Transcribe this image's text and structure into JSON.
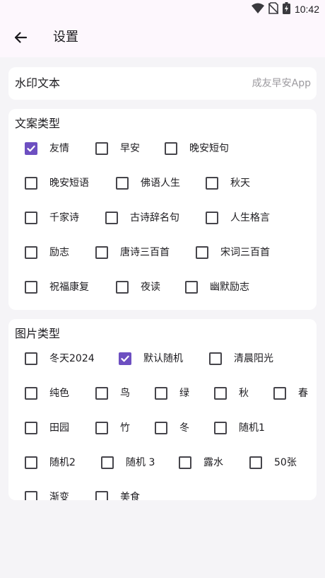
{
  "status": {
    "time": "10:42"
  },
  "header": {
    "title": "设置",
    "back_icon": "arrow-left-icon"
  },
  "watermark": {
    "label": "水印文本",
    "placeholder": "成友早安App",
    "value": ""
  },
  "text_types": {
    "title": "文案类型",
    "options": [
      {
        "label": "友情",
        "checked": true
      },
      {
        "label": "早安",
        "checked": false
      },
      {
        "label": "晚安短句",
        "checked": false
      },
      {
        "label": "晚安短语",
        "checked": false
      },
      {
        "label": "佛语人生",
        "checked": false
      },
      {
        "label": "秋天",
        "checked": false
      },
      {
        "label": "千家诗",
        "checked": false
      },
      {
        "label": "古诗辞名句",
        "checked": false
      },
      {
        "label": "人生格言",
        "checked": false
      },
      {
        "label": "励志",
        "checked": false
      },
      {
        "label": "唐诗三百首",
        "checked": false
      },
      {
        "label": "宋词三百首",
        "checked": false
      },
      {
        "label": "祝福康复",
        "checked": false
      },
      {
        "label": "夜读",
        "checked": false
      },
      {
        "label": "幽默励志",
        "checked": false
      }
    ]
  },
  "image_types": {
    "title": "图片类型",
    "options": [
      {
        "label": "冬天2024",
        "checked": false
      },
      {
        "label": "默认随机",
        "checked": true
      },
      {
        "label": "清晨阳光",
        "checked": false
      },
      {
        "label": "纯色",
        "checked": false
      },
      {
        "label": "鸟",
        "checked": false
      },
      {
        "label": "绿",
        "checked": false
      },
      {
        "label": "秋",
        "checked": false
      },
      {
        "label": "春",
        "checked": false
      },
      {
        "label": "田园",
        "checked": false
      },
      {
        "label": "竹",
        "checked": false
      },
      {
        "label": "冬",
        "checked": false
      },
      {
        "label": "随机1",
        "checked": false
      },
      {
        "label": "随机2",
        "checked": false
      },
      {
        "label": "随机 3",
        "checked": false
      },
      {
        "label": "露水",
        "checked": false
      },
      {
        "label": "50张",
        "checked": false
      },
      {
        "label": "渐变",
        "checked": false
      },
      {
        "label": "美食",
        "checked": false
      }
    ]
  },
  "colors": {
    "accent": "#6d4fc1",
    "bar_bg": "#fdf7fd",
    "page_bg": "#f5f4f7"
  }
}
